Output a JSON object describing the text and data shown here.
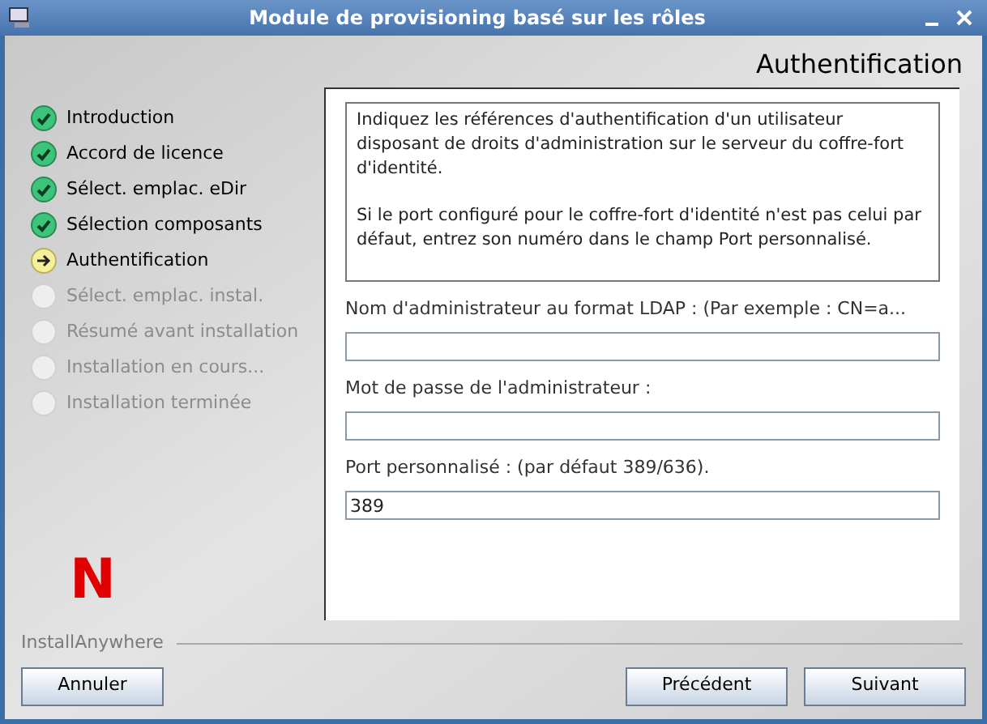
{
  "window": {
    "title": "Module de provisioning basé sur les rôles"
  },
  "header": {
    "title": "Authentification"
  },
  "steps": [
    {
      "label": "Introduction",
      "kind": "done"
    },
    {
      "label": "Accord de licence",
      "kind": "done"
    },
    {
      "label": "Sélect. emplac. eDir",
      "kind": "done"
    },
    {
      "label": "Sélection composants",
      "kind": "done"
    },
    {
      "label": "Authentification",
      "kind": "current"
    },
    {
      "label": "Sélect. emplac. instal.",
      "kind": "pending"
    },
    {
      "label": "Résumé avant installation",
      "kind": "pending"
    },
    {
      "label": "Installation en cours...",
      "kind": "pending"
    },
    {
      "label": "Installation terminée",
      "kind": "pending"
    }
  ],
  "logo": {
    "letter": "N"
  },
  "description": [
    "Indiquez les références d'authentification d'un utilisateur disposant de droits d'administration sur le serveur du coffre-fort d'identité.",
    "Si le port configuré pour le coffre-fort d'identité n'est pas celui par défaut, entrez son numéro dans le champ Port personnalisé."
  ],
  "fields": [
    {
      "label": "Nom d'administrateur au format LDAP : (Par exemple : CN=a..."
    },
    {
      "label": "Mot de passe de l'administrateur :"
    },
    {
      "label": "Port personnalisé : (par défaut 389/636).",
      "value": "389"
    }
  ],
  "brand": "InstallAnywhere",
  "buttons": {
    "cancel": "Annuler",
    "back": "Précédent",
    "next": "Suivant"
  }
}
